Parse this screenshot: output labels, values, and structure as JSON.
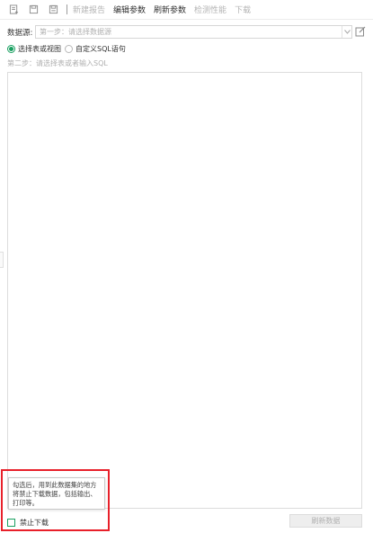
{
  "toolbar": {
    "icons": [
      "new-page-icon",
      "save-icon",
      "save-as-icon"
    ],
    "items": [
      {
        "label": "新建报告",
        "state": "disabled"
      },
      {
        "label": "编辑参数",
        "state": "active"
      },
      {
        "label": "刷新参数",
        "state": "active"
      },
      {
        "label": "检测性能",
        "state": "disabled"
      },
      {
        "label": "下载",
        "state": "disabled"
      }
    ]
  },
  "datasource": {
    "label": "数据源:",
    "placeholder": "第一步：请选择数据源",
    "arrow_icon": "chevron-down-icon",
    "edit_icon": "edit-icon"
  },
  "mode": {
    "options": [
      {
        "label": "选择表或视图",
        "checked": true
      },
      {
        "label": "自定义SQL语句",
        "checked": false
      }
    ]
  },
  "step2_hint": "第二步：请选择表或者输入SQL",
  "tooltip": {
    "text": "勾选后，用到此数据集的地方将禁止下载数据，包括输出、打印等。"
  },
  "footer": {
    "forbid_download_label": "禁止下载",
    "forbid_download_checked": false,
    "refresh_button_label": "刷新数据"
  },
  "colors": {
    "accent": "#1aa061",
    "highlight": "#e8202a",
    "disabled_text": "#b0b0b0"
  }
}
